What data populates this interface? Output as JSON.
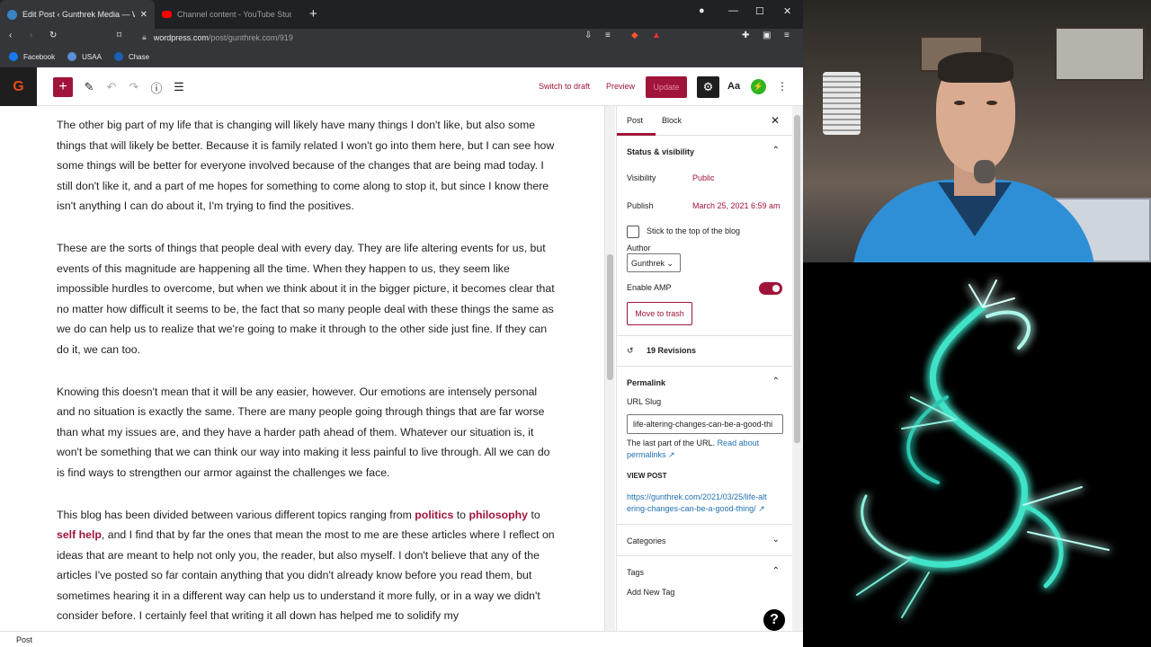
{
  "browser": {
    "tabs": [
      {
        "title": "Edit Post ‹ Gunthrek Media — W",
        "active": true
      },
      {
        "title": "Channel content - YouTube Studio",
        "active": false
      }
    ],
    "url_domain": "wordpress.com",
    "url_path": "/post/gunthrek.com/919",
    "bookmarks": [
      "Facebook",
      "USAA",
      "Chase"
    ]
  },
  "toolbar": {
    "logo": "G",
    "switch_to_draft": "Switch to draft",
    "preview": "Preview",
    "update": "Update",
    "typography": "Aa"
  },
  "editor": {
    "paragraphs": [
      "The other big part of my life that is changing will likely have many things I don't like, but also some things that will likely be better.  Because it is family related I won't go into them here, but I can see how some things will be better for everyone involved because of the changes that are being mad today.  I still don't like it, and a part of me hopes for something to come along to stop it, but since I know there isn't anything I can do about it, I'm trying to find the positives.",
      "These are the sorts of things that people deal with every day.  They are life altering events for us, but events of this magnitude are happening all the time.  When they happen to us, they seem like impossible hurdles to overcome, but when we think about it in the bigger picture, it becomes clear that no matter how difficult it seems to be, the fact that so many people deal with these things the same as we do can help us to realize that we're going to make it through to the other side just fine.  If they can do it, we can too.",
      "Knowing this doesn't mean that it will be any easier, however.  Our emotions are intensely personal and no situation is exactly the same.  There are many people going through things that are far worse than what my issues are, and they have a harder path ahead of them.  Whatever our situation is, it won't be something that we can think our way into making it less painful to live through.  All we can do is find ways to strengthen our armor against the challenges we face."
    ],
    "last_para": {
      "pre": "This blog has been divided between various different topics ranging from ",
      "link1": "politics",
      "mid1": " to ",
      "link2": "philosophy",
      "mid2": " to ",
      "link3": "self help",
      "post": ", and I find that by far the ones that mean the most to me are these articles where I reflect on ideas that are meant to help not only you, the reader, but also myself.  I don't believe that any of the articles I've posted so far contain anything that you didn't already know before you read them, but sometimes hearing it in a different way can help us to understand it more fully, or in a way we didn't consider before.  I certainly feel that writing it all down has helped me to solidify my"
    }
  },
  "sidebar": {
    "tab_post": "Post",
    "tab_block": "Block",
    "status_title": "Status & visibility",
    "visibility_label": "Visibility",
    "visibility_value": "Public",
    "publish_label": "Publish",
    "publish_value": "March 25, 2021 6:59 am",
    "sticky_label": "Stick to the top of the blog",
    "author_label": "Author",
    "author_value": "Gunthrek",
    "amp_label": "Enable AMP",
    "trash": "Move to trash",
    "revisions": "19 Revisions",
    "permalink_title": "Permalink",
    "slug_label": "URL Slug",
    "slug_value": "life-altering-changes-can-be-a-good-thi",
    "slug_help": "The last part of the URL.",
    "slug_help_link": "Read about permalinks",
    "view_post": "VIEW POST",
    "post_url": "https://gunthrek.com/2021/03/25/life-altering-changes-can-be-a-good-thing/",
    "categories": "Categories",
    "tags": "Tags",
    "add_tag": "Add New Tag"
  },
  "footer": {
    "breadcrumb": "Post"
  },
  "colors": {
    "accent": "#a0143a",
    "link": "#2271b1",
    "toggle": "#a0143a"
  }
}
